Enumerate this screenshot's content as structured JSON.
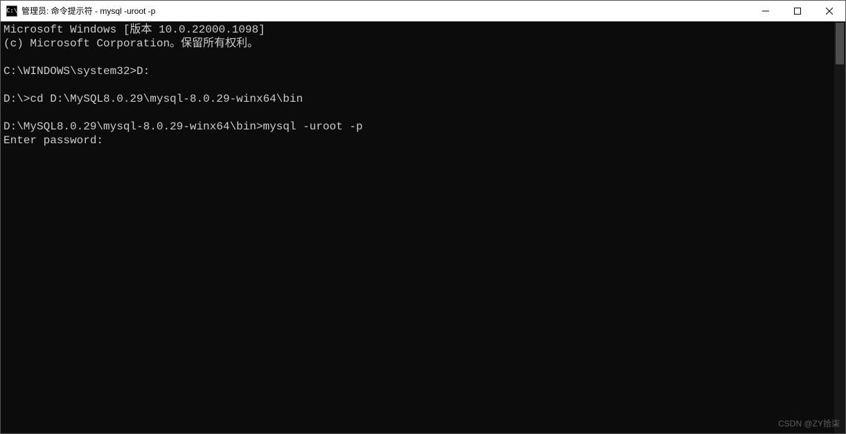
{
  "window": {
    "title": "管理员: 命令提示符 - mysql  -uroot -p",
    "icon_label": "C:\\"
  },
  "terminal": {
    "lines": [
      "Microsoft Windows [版本 10.0.22000.1098]",
      "(c) Microsoft Corporation。保留所有权利。",
      "",
      "C:\\WINDOWS\\system32>D:",
      "",
      "D:\\>cd D:\\MySQL8.0.29\\mysql-8.0.29-winx64\\bin",
      "",
      "D:\\MySQL8.0.29\\mysql-8.0.29-winx64\\bin>mysql -uroot -p",
      "Enter password:"
    ]
  },
  "watermark": "CSDN @ZY拾柒"
}
